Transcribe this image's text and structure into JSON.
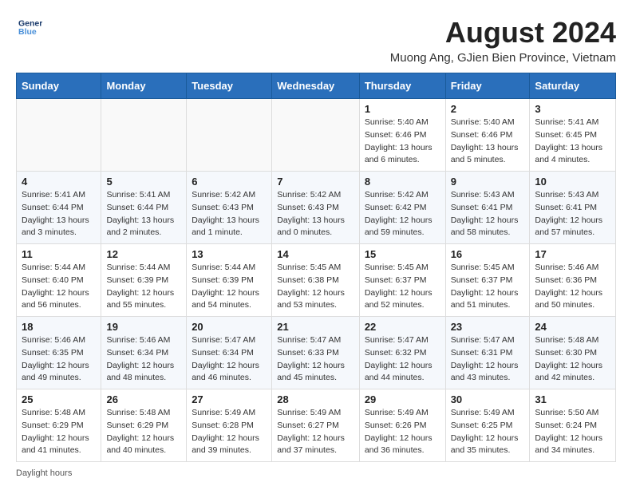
{
  "logo": {
    "line1": "General",
    "line2": "Blue"
  },
  "title": "August 2024",
  "subtitle": "Muong Ang, GJien Bien Province, Vietnam",
  "days_of_week": [
    "Sunday",
    "Monday",
    "Tuesday",
    "Wednesday",
    "Thursday",
    "Friday",
    "Saturday"
  ],
  "weeks": [
    [
      {
        "day": "",
        "info": ""
      },
      {
        "day": "",
        "info": ""
      },
      {
        "day": "",
        "info": ""
      },
      {
        "day": "",
        "info": ""
      },
      {
        "day": "1",
        "info": "Sunrise: 5:40 AM\nSunset: 6:46 PM\nDaylight: 13 hours and 6 minutes."
      },
      {
        "day": "2",
        "info": "Sunrise: 5:40 AM\nSunset: 6:46 PM\nDaylight: 13 hours and 5 minutes."
      },
      {
        "day": "3",
        "info": "Sunrise: 5:41 AM\nSunset: 6:45 PM\nDaylight: 13 hours and 4 minutes."
      }
    ],
    [
      {
        "day": "4",
        "info": "Sunrise: 5:41 AM\nSunset: 6:44 PM\nDaylight: 13 hours and 3 minutes."
      },
      {
        "day": "5",
        "info": "Sunrise: 5:41 AM\nSunset: 6:44 PM\nDaylight: 13 hours and 2 minutes."
      },
      {
        "day": "6",
        "info": "Sunrise: 5:42 AM\nSunset: 6:43 PM\nDaylight: 13 hours and 1 minute."
      },
      {
        "day": "7",
        "info": "Sunrise: 5:42 AM\nSunset: 6:43 PM\nDaylight: 13 hours and 0 minutes."
      },
      {
        "day": "8",
        "info": "Sunrise: 5:42 AM\nSunset: 6:42 PM\nDaylight: 12 hours and 59 minutes."
      },
      {
        "day": "9",
        "info": "Sunrise: 5:43 AM\nSunset: 6:41 PM\nDaylight: 12 hours and 58 minutes."
      },
      {
        "day": "10",
        "info": "Sunrise: 5:43 AM\nSunset: 6:41 PM\nDaylight: 12 hours and 57 minutes."
      }
    ],
    [
      {
        "day": "11",
        "info": "Sunrise: 5:44 AM\nSunset: 6:40 PM\nDaylight: 12 hours and 56 minutes."
      },
      {
        "day": "12",
        "info": "Sunrise: 5:44 AM\nSunset: 6:39 PM\nDaylight: 12 hours and 55 minutes."
      },
      {
        "day": "13",
        "info": "Sunrise: 5:44 AM\nSunset: 6:39 PM\nDaylight: 12 hours and 54 minutes."
      },
      {
        "day": "14",
        "info": "Sunrise: 5:45 AM\nSunset: 6:38 PM\nDaylight: 12 hours and 53 minutes."
      },
      {
        "day": "15",
        "info": "Sunrise: 5:45 AM\nSunset: 6:37 PM\nDaylight: 12 hours and 52 minutes."
      },
      {
        "day": "16",
        "info": "Sunrise: 5:45 AM\nSunset: 6:37 PM\nDaylight: 12 hours and 51 minutes."
      },
      {
        "day": "17",
        "info": "Sunrise: 5:46 AM\nSunset: 6:36 PM\nDaylight: 12 hours and 50 minutes."
      }
    ],
    [
      {
        "day": "18",
        "info": "Sunrise: 5:46 AM\nSunset: 6:35 PM\nDaylight: 12 hours and 49 minutes."
      },
      {
        "day": "19",
        "info": "Sunrise: 5:46 AM\nSunset: 6:34 PM\nDaylight: 12 hours and 48 minutes."
      },
      {
        "day": "20",
        "info": "Sunrise: 5:47 AM\nSunset: 6:34 PM\nDaylight: 12 hours and 46 minutes."
      },
      {
        "day": "21",
        "info": "Sunrise: 5:47 AM\nSunset: 6:33 PM\nDaylight: 12 hours and 45 minutes."
      },
      {
        "day": "22",
        "info": "Sunrise: 5:47 AM\nSunset: 6:32 PM\nDaylight: 12 hours and 44 minutes."
      },
      {
        "day": "23",
        "info": "Sunrise: 5:47 AM\nSunset: 6:31 PM\nDaylight: 12 hours and 43 minutes."
      },
      {
        "day": "24",
        "info": "Sunrise: 5:48 AM\nSunset: 6:30 PM\nDaylight: 12 hours and 42 minutes."
      }
    ],
    [
      {
        "day": "25",
        "info": "Sunrise: 5:48 AM\nSunset: 6:29 PM\nDaylight: 12 hours and 41 minutes."
      },
      {
        "day": "26",
        "info": "Sunrise: 5:48 AM\nSunset: 6:29 PM\nDaylight: 12 hours and 40 minutes."
      },
      {
        "day": "27",
        "info": "Sunrise: 5:49 AM\nSunset: 6:28 PM\nDaylight: 12 hours and 39 minutes."
      },
      {
        "day": "28",
        "info": "Sunrise: 5:49 AM\nSunset: 6:27 PM\nDaylight: 12 hours and 37 minutes."
      },
      {
        "day": "29",
        "info": "Sunrise: 5:49 AM\nSunset: 6:26 PM\nDaylight: 12 hours and 36 minutes."
      },
      {
        "day": "30",
        "info": "Sunrise: 5:49 AM\nSunset: 6:25 PM\nDaylight: 12 hours and 35 minutes."
      },
      {
        "day": "31",
        "info": "Sunrise: 5:50 AM\nSunset: 6:24 PM\nDaylight: 12 hours and 34 minutes."
      }
    ]
  ],
  "footer": "Daylight hours"
}
